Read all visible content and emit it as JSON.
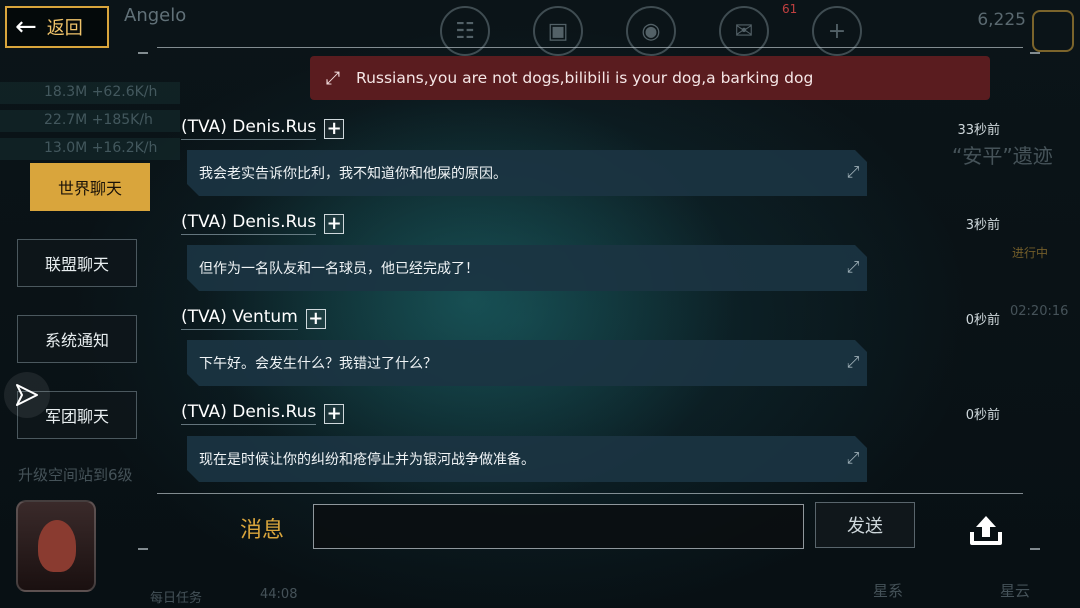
{
  "header": {
    "back_label": "返回",
    "player_name": "Angelo",
    "credits": "6,225",
    "notification_count": "61"
  },
  "background": {
    "resources": [
      "18.3M +62.6K/h",
      "22.7M +185K/h",
      "13.0M +16.2K/h"
    ],
    "upgrade_text": "升级空间站到6级",
    "bottom_nav": [
      "每日任务",
      "44:08",
      "星系",
      "星云"
    ],
    "right_text": "“安平”遗迹",
    "progress_label": "进行中",
    "progress_timer": "02:20:16"
  },
  "alert": {
    "text": "Russians,you are not dogs,bilibili is your dog,a barking dog"
  },
  "tabs": [
    {
      "label": "世界聊天",
      "active": true
    },
    {
      "label": "联盟聊天",
      "active": false
    },
    {
      "label": "系统通知",
      "active": false
    },
    {
      "label": "军团聊天",
      "active": false
    }
  ],
  "messages": [
    {
      "sender": "(TVA) Denis.Rus",
      "time": "33秒前",
      "text": "我会老实告诉你比利，我不知道你和他屎的原因。"
    },
    {
      "sender": "(TVA) Denis.Rus",
      "time": "3秒前",
      "text": "但作为一名队友和一名球员，他已经完成了！"
    },
    {
      "sender": "(TVA) Ventum",
      "time": "0秒前",
      "text": "下午好。会发生什么？我错过了什么？"
    },
    {
      "sender": "(TVA) Denis.Rus",
      "time": "0秒前",
      "text": "现在是时候让你的纠纷和疮停止并为银河战争做准备。"
    }
  ],
  "composer": {
    "label": "消息",
    "input_value": "",
    "send_label": "发送"
  },
  "colors": {
    "accent": "#d9a53c",
    "alert_bg": "#5a1c1f",
    "bubble_bg": "#1b3442"
  }
}
